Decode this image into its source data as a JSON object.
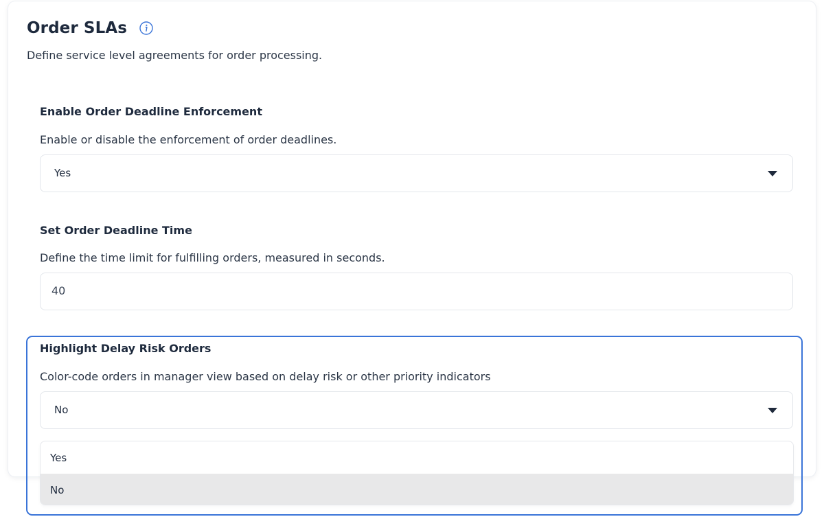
{
  "header": {
    "title": "Order SLAs",
    "info_icon": "info-icon",
    "subtitle": "Define service level agreements for order processing."
  },
  "fields": {
    "deadline_enforcement": {
      "label": "Enable Order Deadline Enforcement",
      "description": "Enable or disable the enforcement of order deadlines.",
      "value": "Yes"
    },
    "deadline_time": {
      "label": "Set Order Deadline Time",
      "description": "Define the time limit for fulfilling orders, measured in seconds.",
      "value": "40"
    },
    "delay_risk": {
      "label": "Highlight Delay Risk Orders",
      "description": "Color-code orders in manager view based on delay risk or other priority indicators",
      "value": "No",
      "options": [
        "Yes",
        "No"
      ]
    }
  },
  "colors": {
    "focus_border": "#3a74d8",
    "info_icon": "#3a74d8",
    "selected_option_bg": "#e8e8e9"
  }
}
